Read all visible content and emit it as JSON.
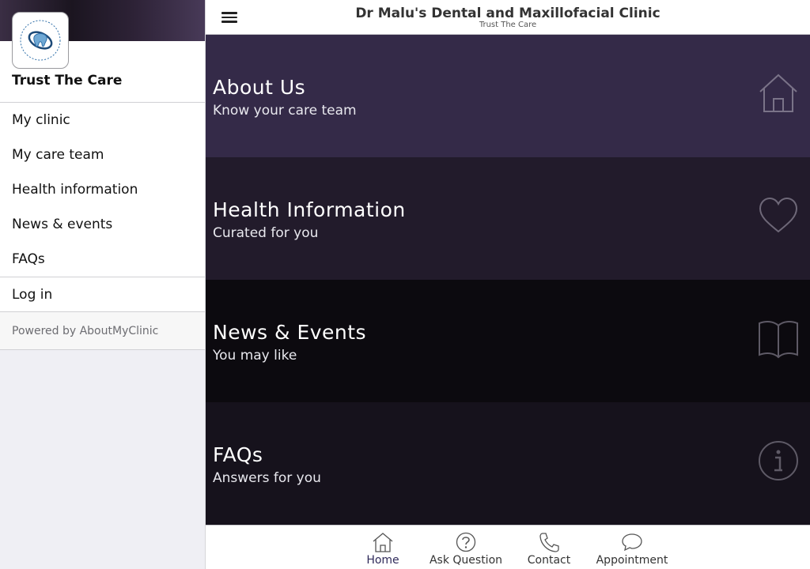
{
  "sidebar": {
    "tagline": "Trust The Care",
    "logo_alt": "Dr Malu's Dental & Maxillofacial Clinic logo",
    "items": [
      {
        "label": "My clinic"
      },
      {
        "label": "My care team"
      },
      {
        "label": "Health information"
      },
      {
        "label": "News & events"
      },
      {
        "label": "FAQs"
      }
    ],
    "login_label": "Log in",
    "powered_by": "Powered by AboutMyClinic"
  },
  "header": {
    "title": "Dr Malu's Dental and Maxillofacial Clinic",
    "subtitle": "Trust The Care",
    "menu_icon": "hamburger-icon"
  },
  "tiles": [
    {
      "title": "About Us",
      "subtitle": "Know your care team",
      "icon": "home-icon",
      "color": "#342a48"
    },
    {
      "title": "Health Information",
      "subtitle": "Curated for you",
      "icon": "heart-icon",
      "color": "#221b2b"
    },
    {
      "title": "News & Events",
      "subtitle": "You may like",
      "icon": "book-icon",
      "color": "#0c0a0f"
    },
    {
      "title": "FAQs",
      "subtitle": "Answers for you",
      "icon": "info-icon",
      "color": "#16121c"
    }
  ],
  "tabbar": {
    "tabs": [
      {
        "label": "Home",
        "icon": "home-icon",
        "active": true
      },
      {
        "label": "Ask Question",
        "icon": "question-icon"
      },
      {
        "label": "Contact",
        "icon": "phone-icon"
      },
      {
        "label": "Appointment",
        "icon": "chat-bubble-icon"
      }
    ]
  },
  "colors": {
    "accent": "#2f2a5a",
    "sidebar_bg": "#efeff4"
  }
}
